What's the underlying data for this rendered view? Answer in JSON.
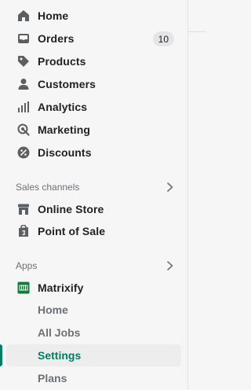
{
  "nav": {
    "home": "Home",
    "orders": "Orders",
    "orders_badge": "10",
    "products": "Products",
    "customers": "Customers",
    "analytics": "Analytics",
    "marketing": "Marketing",
    "discounts": "Discounts"
  },
  "sales_channels": {
    "title": "Sales channels",
    "online_store": "Online Store",
    "point_of_sale": "Point of Sale"
  },
  "apps": {
    "title": "Apps",
    "matrixify": "Matrixify",
    "sub_items": {
      "home": "Home",
      "all_jobs": "All Jobs",
      "settings": "Settings",
      "plans": "Plans"
    },
    "active_item": "Settings"
  },
  "colors": {
    "active": "#008060",
    "app_icon": "#0e7c3a"
  }
}
